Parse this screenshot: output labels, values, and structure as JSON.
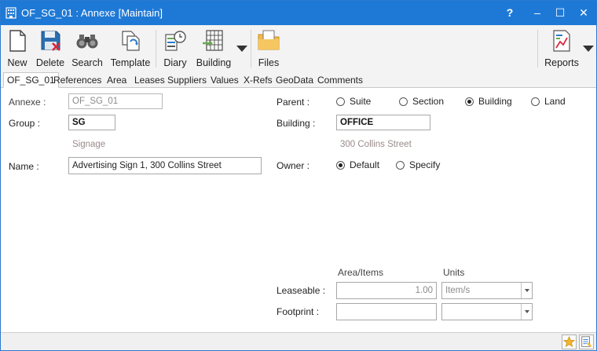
{
  "window": {
    "title": "OF_SG_01 : Annexe [Maintain]",
    "controls": {
      "help": "?",
      "minimize": "–",
      "maximize": "☐",
      "close": "✕"
    }
  },
  "toolbar": {
    "new": "New",
    "delete": "Delete",
    "search": "Search",
    "template": "Template",
    "diary": "Diary",
    "building": "Building",
    "files": "Files",
    "reports": "Reports"
  },
  "tabs": [
    "OF_SG_01",
    "References",
    "Area",
    "Leases",
    "Suppliers",
    "Values",
    "X-Refs",
    "GeoData",
    "Comments"
  ],
  "form": {
    "annexe_label": "Annexe :",
    "annexe_value": "OF_SG_01",
    "group_label": "Group :",
    "group_value": "SG",
    "group_hint": "Signage",
    "name_label": "Name :",
    "name_value": "Advertising Sign 1, 300 Collins Street",
    "parent_label": "Parent :",
    "parent_options": [
      "Suite",
      "Section",
      "Building",
      "Land"
    ],
    "parent_selected": "Building",
    "building_label": "Building :",
    "building_value": "OFFICE",
    "building_hint": "300 Collins Street",
    "owner_label": "Owner :",
    "owner_options": [
      "Default",
      "Specify"
    ],
    "owner_selected": "Default",
    "area_items_header": "Area/Items",
    "units_header": "Units",
    "leaseable_label": "Leaseable :",
    "leaseable_value": "1.00",
    "leaseable_units": "Item/s",
    "footprint_label": "Footprint :",
    "footprint_value": "",
    "footprint_units": ""
  },
  "colors": {
    "titlebar": "#1e79d6",
    "hint_text": "#9a8a8a",
    "background": "#f3f3f3"
  },
  "icons": {
    "app": "building-icon",
    "new": "new-document-icon",
    "delete": "delete-disk-icon",
    "search": "binoculars-icon",
    "template": "template-icon",
    "diary": "diary-clock-icon",
    "building": "building-grid-icon",
    "files": "folder-icon",
    "reports": "report-chart-icon",
    "status_favorite": "star-icon",
    "status_notes": "notes-icon"
  }
}
